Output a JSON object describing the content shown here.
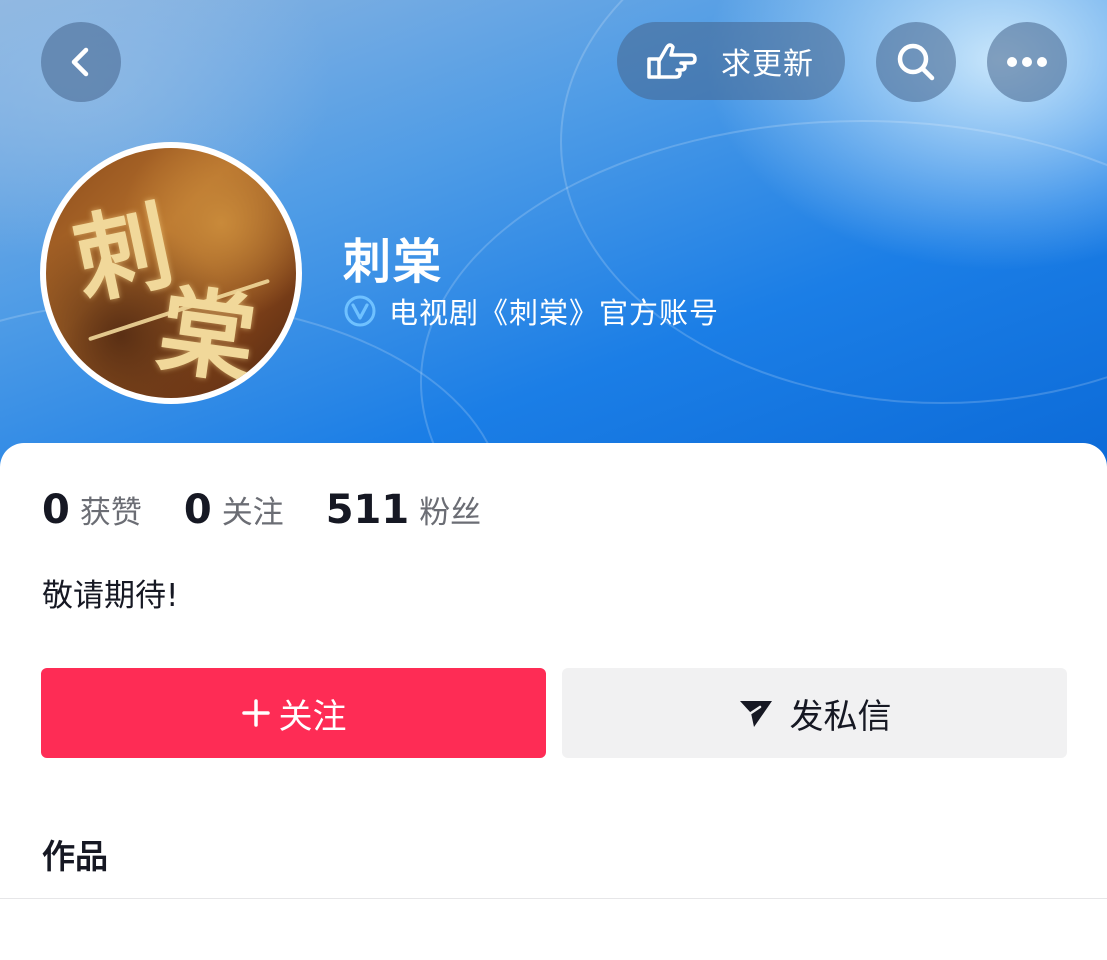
{
  "header": {
    "back_icon": "chevron-left-icon",
    "request_update": {
      "icon": "pointing-hand-icon",
      "label": "求更新"
    },
    "search_icon": "search-icon",
    "more_icon": "more-horizontal-icon",
    "gradient_colors": [
      "#8fb6e0",
      "#4f9ce6",
      "#1b7ee6",
      "#0a68d6"
    ]
  },
  "profile": {
    "avatar_text": [
      "刺",
      "棠"
    ],
    "name": "刺棠",
    "verified_icon": "verified-badge-icon",
    "verified_text": "电视剧《刺棠》官方账号"
  },
  "stats": [
    {
      "value": "0",
      "label": "获赞"
    },
    {
      "value": "0",
      "label": "关注"
    },
    {
      "value": "511",
      "label": "粉丝"
    }
  ],
  "bio": "敬请期待!",
  "actions": {
    "follow": {
      "icon": "plus-icon",
      "label": "关注",
      "color": "#fe2c55"
    },
    "message": {
      "icon": "send-icon",
      "label": "发私信",
      "color": "#f1f1f2"
    }
  },
  "works_title": "作品"
}
